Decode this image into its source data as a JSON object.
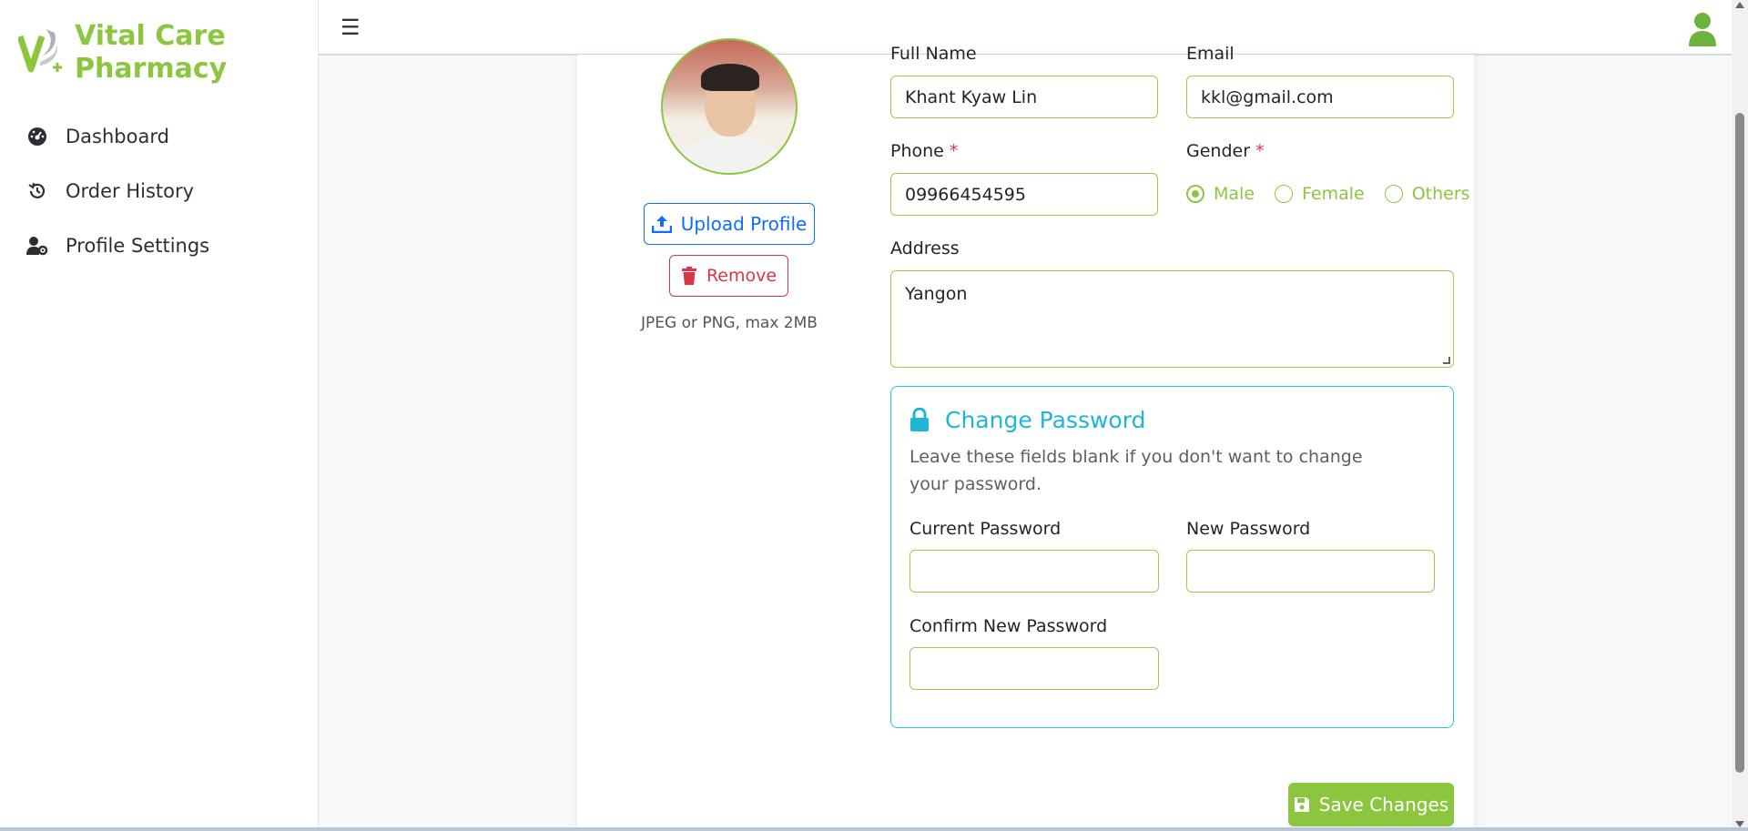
{
  "brand": {
    "line1": "Vital Care",
    "line2": "Pharmacy",
    "color": "#8cc63f"
  },
  "sidebar": {
    "items": [
      {
        "label": "Dashboard",
        "icon": "dashboard-gauge-icon"
      },
      {
        "label": "Order History",
        "icon": "history-icon"
      },
      {
        "label": "Profile Settings",
        "icon": "user-gear-icon"
      }
    ]
  },
  "topbar": {
    "menu_icon": "hamburger-icon",
    "user_icon": "user-icon"
  },
  "profile": {
    "upload_label": "Upload Profile",
    "remove_label": "Remove",
    "file_hint": "JPEG or PNG, max 2MB"
  },
  "form": {
    "full_name": {
      "label": "Full Name",
      "value": "Khant Kyaw Lin"
    },
    "email": {
      "label": "Email",
      "value": "kkl@gmail.com"
    },
    "phone": {
      "label": "Phone",
      "required": "*",
      "value": "09966454595"
    },
    "gender": {
      "label": "Gender",
      "required": "*",
      "options": [
        "Male",
        "Female",
        "Others"
      ],
      "selected": "Male"
    },
    "address": {
      "label": "Address",
      "value": "Yangon"
    }
  },
  "password": {
    "title": "Change Password",
    "description": "Leave these fields blank if you don't want to change your password.",
    "current_label": "Current Password",
    "new_label": "New Password",
    "confirm_label": "Confirm New Password",
    "current_value": "",
    "new_value": "",
    "confirm_value": ""
  },
  "save_label": "Save Changes",
  "colors": {
    "accent": "#8cc63f",
    "info": "#1fb6d6",
    "primary": "#0d6efd",
    "danger": "#dc3545"
  }
}
